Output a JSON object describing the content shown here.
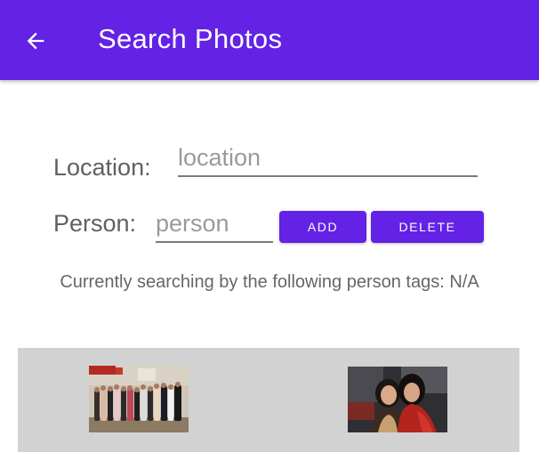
{
  "app_bar": {
    "title": "Search Photos",
    "background": "#6322e6",
    "back_icon": "arrow-left-icon"
  },
  "form": {
    "location_label": "Location:",
    "location_placeholder": "location",
    "location_value": "",
    "person_label": "Person:",
    "person_placeholder": "person",
    "person_value": "",
    "add_label": "ADD",
    "delete_label": "DELETE"
  },
  "status_text": "Currently searching by the following person tags: N/A",
  "results": {
    "background": "#d2d2d2",
    "photos": [
      {
        "name": "group-photo"
      },
      {
        "name": "two-people-photo"
      }
    ]
  }
}
